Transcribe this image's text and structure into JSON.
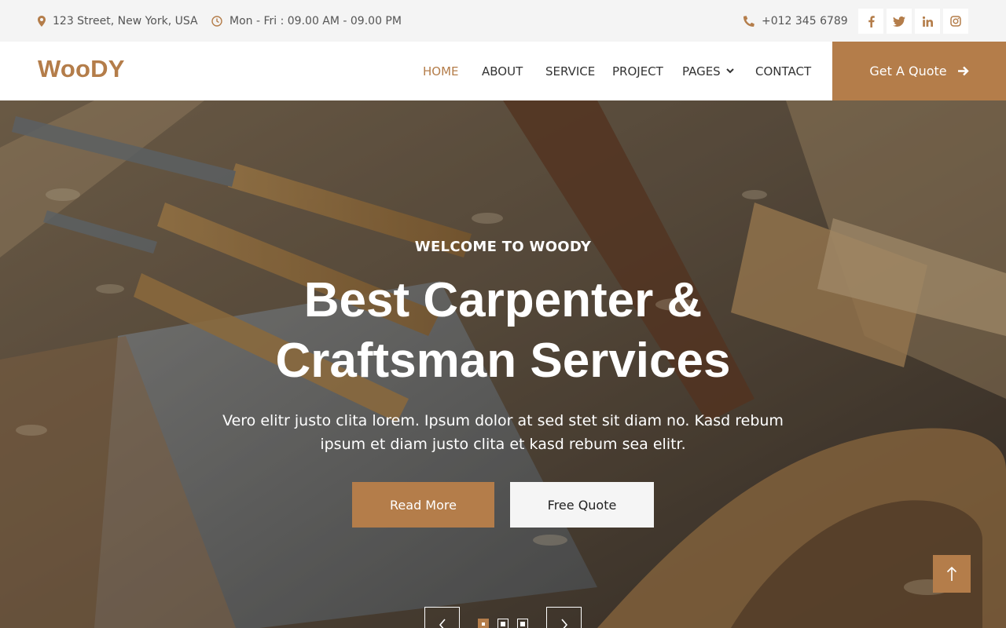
{
  "topbar": {
    "address": "123 Street, New York, USA",
    "hours": "Mon - Fri : 09.00 AM - 09.00 PM",
    "phone": "+012 345 6789",
    "social": [
      "facebook-icon",
      "twitter-icon",
      "linkedin-icon",
      "instagram-icon"
    ]
  },
  "navbar": {
    "brand": "WooDY",
    "items": [
      {
        "label": "HOME"
      },
      {
        "label": "ABOUT"
      },
      {
        "label": "SERVICE"
      },
      {
        "label": "PROJECT"
      },
      {
        "label": "PAGES"
      },
      {
        "label": "CONTACT"
      }
    ],
    "quote_label": "Get A Quote"
  },
  "hero": {
    "welcome": "WELCOME TO WOODY",
    "title_line1": "Best Carpenter &",
    "title_line2": "Craftsman Services",
    "subtitle": "Vero elitr justo clita lorem. Ipsum dolor at sed stet sit diam no. Kasd rebum ipsum et diam justo clita et kasd rebum sea elitr.",
    "primary_button": "Read More",
    "secondary_button": "Free Quote",
    "slides": 3,
    "active_slide": 1
  },
  "colors": {
    "accent": "#b47d4a",
    "topbar_bg": "#f4f4f4",
    "text": "#333333"
  }
}
